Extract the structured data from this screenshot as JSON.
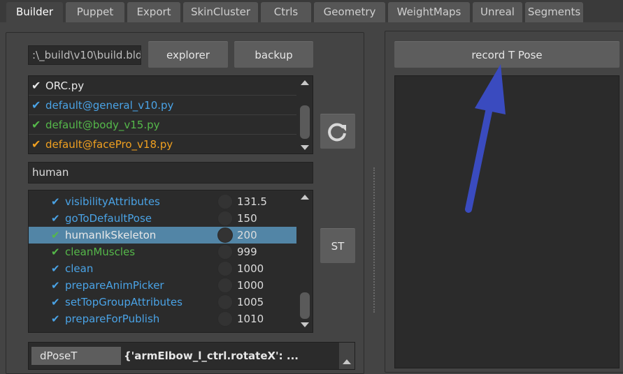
{
  "tabs": [
    "Builder",
    "Puppet",
    "Export",
    "SkinCluster",
    "Ctrls",
    "Geometry",
    "WeightMaps",
    "Unreal",
    "Segments"
  ],
  "active_tab": "Builder",
  "build_path": ":\\_build\\v10\\build.bld",
  "buttons": {
    "explorer": "explorer",
    "backup": "backup",
    "st": "ST",
    "record": "record T Pose",
    "refresh_icon": "refresh-icon"
  },
  "colors": {
    "white": "#e8e8e8",
    "blue": "#4aa3e6",
    "green": "#55b84a",
    "orange": "#f0a020",
    "arrow": "#3a4bbf",
    "selection": "#5285a6"
  },
  "files": [
    {
      "name": "ORC.py",
      "color": "white"
    },
    {
      "name": "default@general_v10.py",
      "color": "blue"
    },
    {
      "name": "default@body_v15.py",
      "color": "green"
    },
    {
      "name": "default@facePro_v18.py",
      "color": "orange"
    }
  ],
  "filter": "human",
  "steps": [
    {
      "name": "visibilityAttributes",
      "value": "131.5",
      "color": "blue",
      "check": "blue",
      "selected": false
    },
    {
      "name": "goToDefaultPose",
      "value": "150",
      "color": "blue",
      "check": "blue",
      "selected": false
    },
    {
      "name": "humanIkSkeleton",
      "value": "200",
      "color": "white",
      "check": "green",
      "selected": true
    },
    {
      "name": "cleanMuscles",
      "value": "999",
      "color": "green",
      "check": "green",
      "selected": false
    },
    {
      "name": "clean",
      "value": "1000",
      "color": "blue",
      "check": "blue",
      "selected": false
    },
    {
      "name": "prepareAnimPicker",
      "value": "1000",
      "color": "blue",
      "check": "blue",
      "selected": false
    },
    {
      "name": "setTopGroupAttributes",
      "value": "1005",
      "color": "blue",
      "check": "blue",
      "selected": false
    },
    {
      "name": "prepareForPublish",
      "value": "1010",
      "color": "blue",
      "check": "blue",
      "selected": false
    }
  ],
  "attributes": {
    "name": "dPoseT",
    "value": "{'armElbow_l_ctrl.rotateX': ..."
  }
}
